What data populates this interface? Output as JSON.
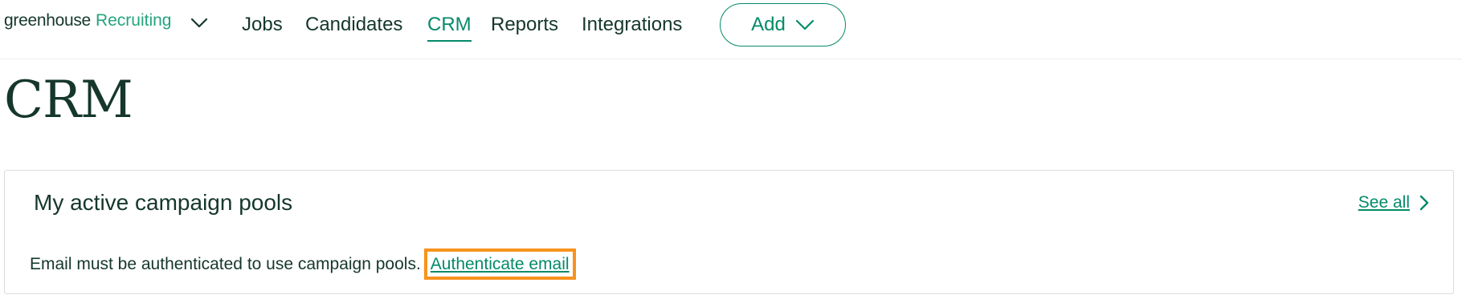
{
  "brand": {
    "name": "greenhouse",
    "product": "Recruiting"
  },
  "nav": {
    "items": [
      {
        "label": "Jobs"
      },
      {
        "label": "Candidates"
      },
      {
        "label": "CRM",
        "active": true
      },
      {
        "label": "Reports"
      },
      {
        "label": "Integrations"
      }
    ],
    "add_label": "Add"
  },
  "page": {
    "title": "CRM"
  },
  "card": {
    "title": "My active campaign pools",
    "see_all_label": "See all",
    "message": "Email must be authenticated to use campaign pools.",
    "auth_link_label": "Authenticate email"
  },
  "icons": {
    "brand_menu": "chevron-down-icon",
    "add_menu": "chevron-down-icon",
    "see_all": "chevron-right-icon"
  },
  "colors": {
    "brand_green": "#24a47f",
    "accent_green": "#048a69",
    "text_dark": "#15372c",
    "highlight_orange": "#f7931e"
  }
}
